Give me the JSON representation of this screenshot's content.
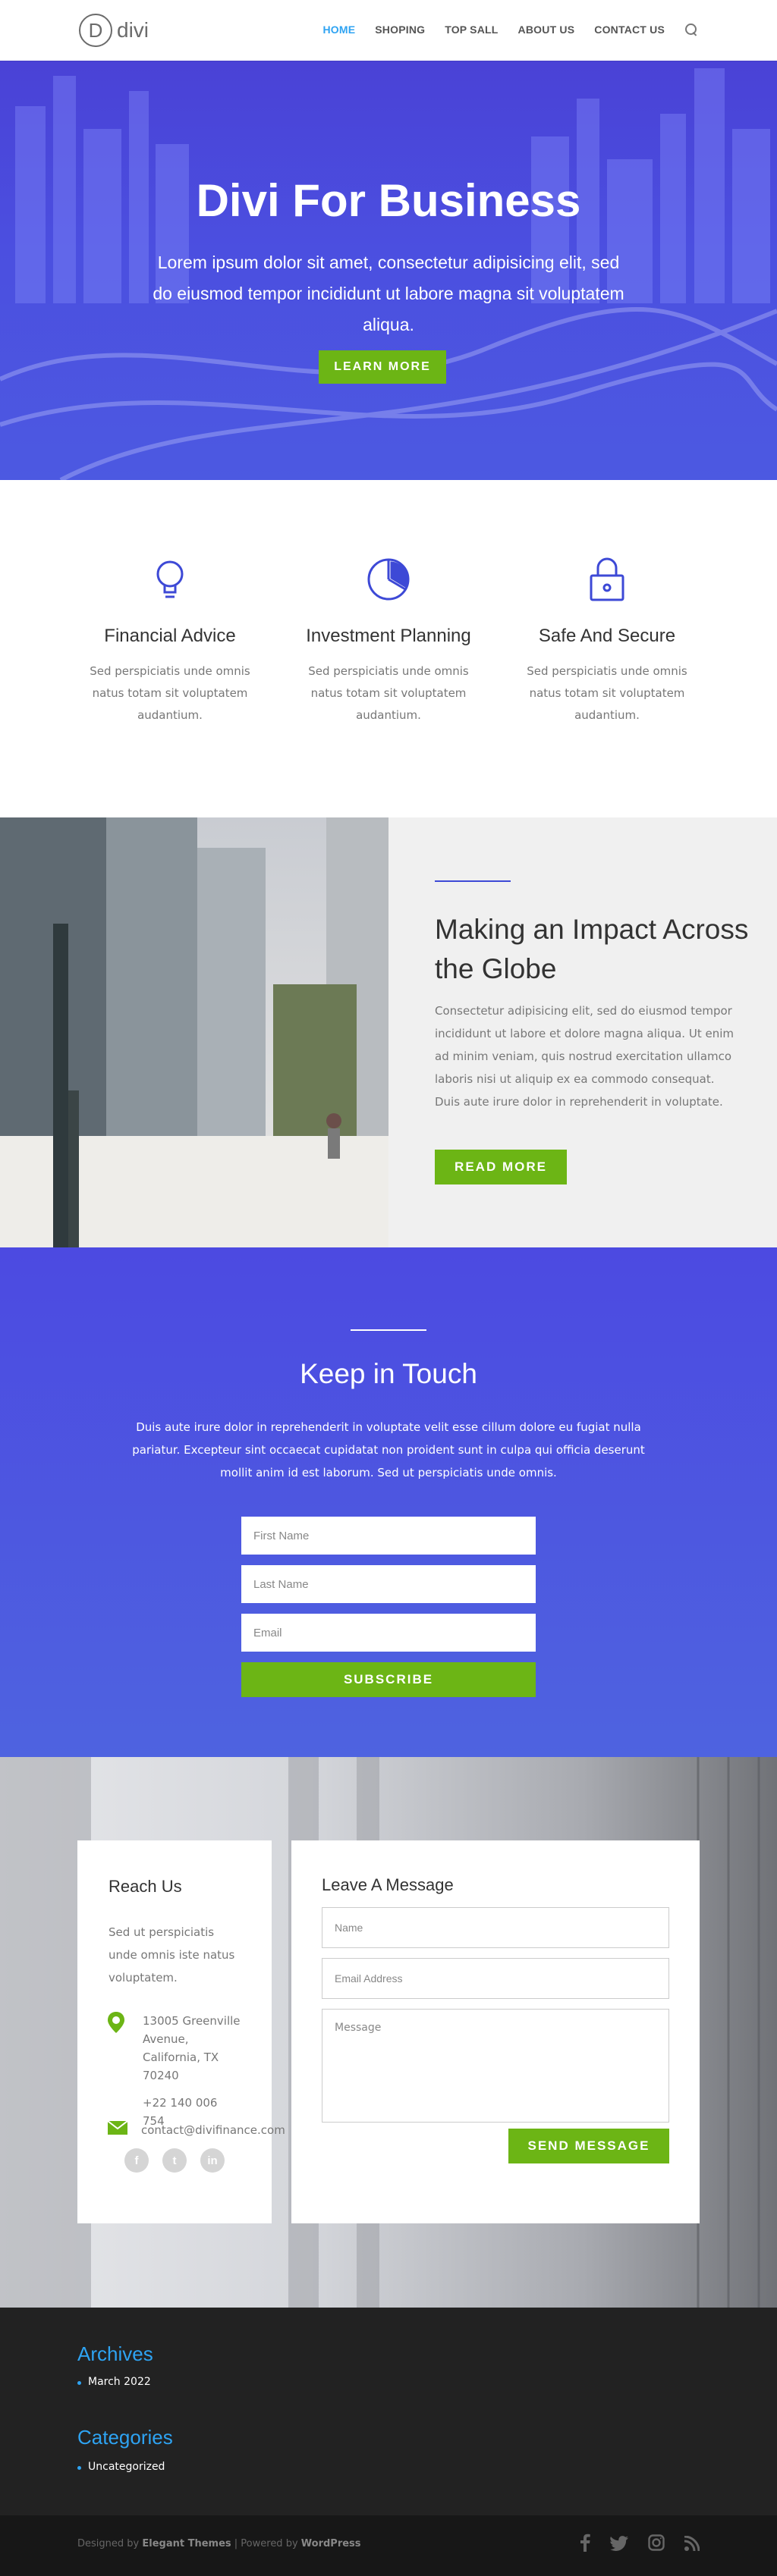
{
  "colors": {
    "accent": "#2ea3f2",
    "brand_blue": "#4a42d6",
    "cta_green": "#6cb515"
  },
  "header": {
    "logo_mark": "D",
    "logo_text": "divi",
    "nav": [
      "HOME",
      "SHOPING",
      "TOP SALL",
      "ABOUT US",
      "CONTACT US"
    ],
    "active_nav": "HOME"
  },
  "hero": {
    "title": "Divi For Business",
    "subtitle": "Lorem ipsum dolor sit amet, consectetur adipisicing elit, sed do eiusmod tempor incididunt ut labore magna sit voluptatem aliqua.",
    "button": "LEARN MORE"
  },
  "features": [
    {
      "icon": "lightbulb-icon",
      "title": "Financial Advice",
      "text": "Sed perspiciatis unde omnis natus totam sit voluptatem audantium."
    },
    {
      "icon": "pie-chart-icon",
      "title": "Investment Planning",
      "text": "Sed perspiciatis unde omnis natus totam sit voluptatem audantium."
    },
    {
      "icon": "lock-icon",
      "title": "Safe And Secure",
      "text": "Sed perspiciatis unde omnis natus totam sit voluptatem audantium."
    }
  ],
  "impact": {
    "title": "Making an Impact Across the Globe",
    "text": "Consectetur adipisicing elit, sed do eiusmod tempor incididunt ut labore et dolore magna aliqua. Ut enim ad minim veniam, quis nostrud exercitation ullamco laboris nisi ut aliquip ex ea commodo consequat. Duis aute irure dolor in reprehenderit in voluptate.",
    "button": "READ MORE"
  },
  "touch": {
    "title": "Keep in Touch",
    "text": "Duis aute irure dolor in reprehenderit in voluptate velit esse cillum dolore eu fugiat nulla pariatur. Excepteur sint occaecat cupidatat non proident sunt in culpa qui officia deserunt mollit anim id est laborum. Sed ut perspiciatis unde omnis.",
    "first_name_placeholder": "First Name",
    "last_name_placeholder": "Last Name",
    "email_placeholder": "Email",
    "button": "SUBSCRIBE"
  },
  "reach": {
    "title": "Reach Us",
    "text": "Sed ut perspiciatis unde omnis iste natus voluptatem.",
    "address": "13005 Greenville Avenue, California, TX 70240",
    "phone": "+22 140 006 754",
    "email": "contact@divifinance.com",
    "socials": [
      "f",
      "t",
      "in"
    ]
  },
  "message": {
    "title": "Leave A Message",
    "name_placeholder": "Name",
    "email_placeholder": "Email Address",
    "message_placeholder": "Message",
    "button": "SEND MESSAGE"
  },
  "footer": {
    "archives_title": "Archives",
    "archives": [
      "March 2022"
    ],
    "categories_title": "Categories",
    "categories": [
      "Uncategorized"
    ],
    "credits_prefix": "Designed by",
    "credits_theme": "Elegant Themes",
    "credits_mid": "| Powered by",
    "credits_wp": "WordPress",
    "icons": [
      "facebook-icon",
      "twitter-icon",
      "instagram-icon",
      "rss-icon"
    ]
  }
}
